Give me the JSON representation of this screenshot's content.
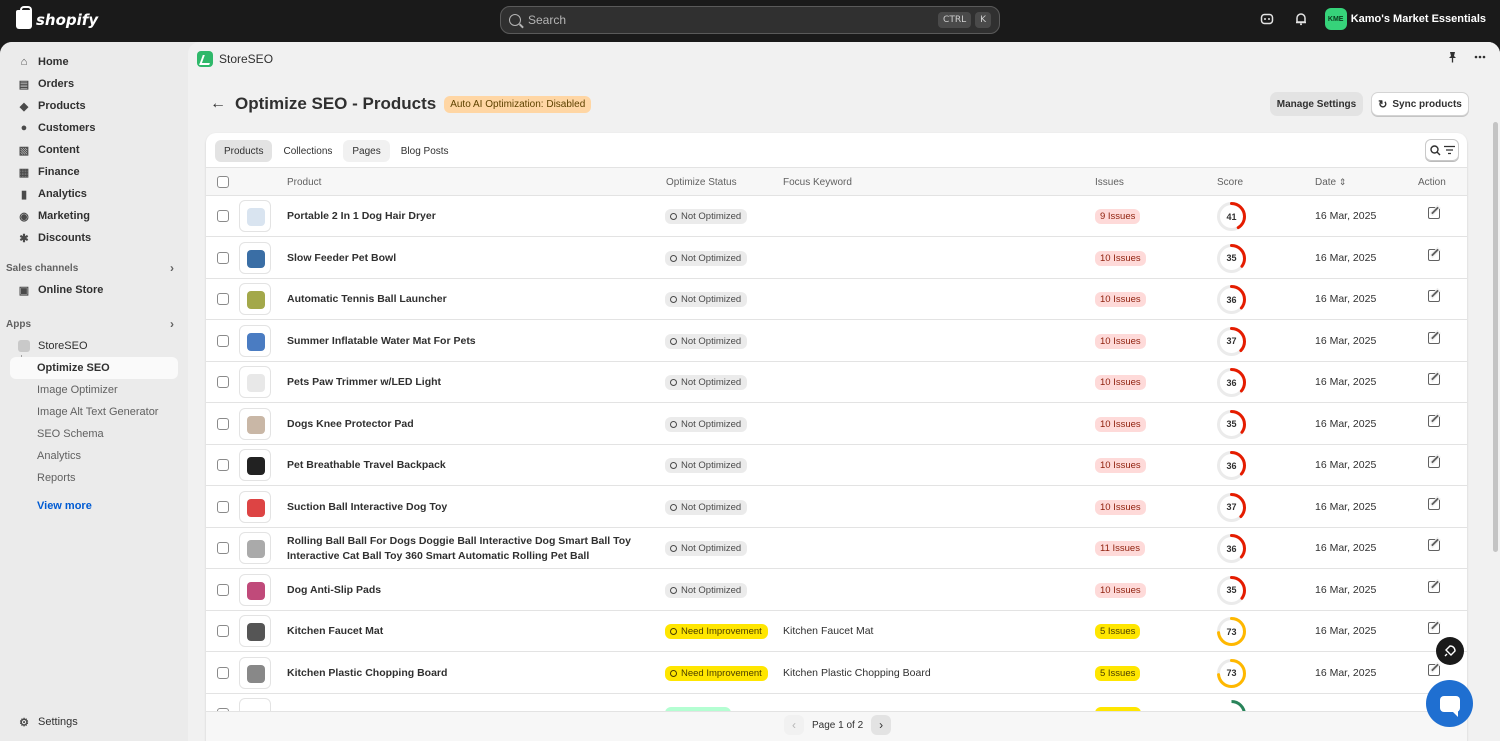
{
  "topbar": {
    "brand": "shopify",
    "search_placeholder": "Search",
    "shortcut_1": "CTRL",
    "shortcut_2": "K",
    "store_initials": "KME",
    "store_name": "Kamo's Market Essentials"
  },
  "sidebar": {
    "items": [
      {
        "label": "Home",
        "icon": "home-icon"
      },
      {
        "label": "Orders",
        "icon": "orders-icon"
      },
      {
        "label": "Products",
        "icon": "tag-icon"
      },
      {
        "label": "Customers",
        "icon": "person-icon"
      },
      {
        "label": "Content",
        "icon": "content-icon"
      },
      {
        "label": "Finance",
        "icon": "bank-icon"
      },
      {
        "label": "Analytics",
        "icon": "chart-icon"
      },
      {
        "label": "Marketing",
        "icon": "target-icon"
      },
      {
        "label": "Discounts",
        "icon": "discount-icon"
      }
    ],
    "sales_channels_label": "Sales channels",
    "online_store": "Online Store",
    "apps_label": "Apps",
    "app_name": "StoreSEO",
    "app_subitems": [
      "Optimize SEO",
      "Image Optimizer",
      "Image Alt Text Generator",
      "SEO Schema",
      "Analytics",
      "Reports"
    ],
    "view_more": "View more",
    "settings": "Settings"
  },
  "appbar": {
    "name": "StoreSEO"
  },
  "page": {
    "title": "Optimize SEO - Products",
    "badge": "Auto AI Optimization: Disabled",
    "manage_settings": "Manage Settings",
    "sync_products": "Sync products"
  },
  "tabs": [
    "Products",
    "Collections",
    "Pages",
    "Blog Posts"
  ],
  "table": {
    "headers": {
      "product": "Product",
      "status": "Optimize Status",
      "keyword": "Focus Keyword",
      "issues": "Issues",
      "score": "Score",
      "date": "Date",
      "action": "Action"
    },
    "rows": [
      {
        "name": "Portable  2 In 1 Dog Hair Dryer",
        "status": "Not Optimized",
        "status_type": "not",
        "keyword": "",
        "issues": "9 Issues",
        "issues_type": "red",
        "score": 41,
        "date": "16 Mar, 2025"
      },
      {
        "name": "Slow Feeder Pet Bowl",
        "status": "Not Optimized",
        "status_type": "not",
        "keyword": "",
        "issues": "10 Issues",
        "issues_type": "red",
        "score": 35,
        "date": "16 Mar, 2025"
      },
      {
        "name": "Automatic Tennis Ball Launcher",
        "status": "Not Optimized",
        "status_type": "not",
        "keyword": "",
        "issues": "10 Issues",
        "issues_type": "red",
        "score": 36,
        "date": "16 Mar, 2025"
      },
      {
        "name": "Summer Inflatable Water Mat For Pets",
        "status": "Not Optimized",
        "status_type": "not",
        "keyword": "",
        "issues": "10 Issues",
        "issues_type": "red",
        "score": 37,
        "date": "16 Mar, 2025"
      },
      {
        "name": "Pets Paw Trimmer w/LED Light",
        "status": "Not Optimized",
        "status_type": "not",
        "keyword": "",
        "issues": "10 Issues",
        "issues_type": "red",
        "score": 36,
        "date": "16 Mar, 2025"
      },
      {
        "name": "Dogs Knee Protector Pad",
        "status": "Not Optimized",
        "status_type": "not",
        "keyword": "",
        "issues": "10 Issues",
        "issues_type": "red",
        "score": 35,
        "date": "16 Mar, 2025"
      },
      {
        "name": "Pet Breathable Travel Backpack",
        "status": "Not Optimized",
        "status_type": "not",
        "keyword": "",
        "issues": "10 Issues",
        "issues_type": "red",
        "score": 36,
        "date": "16 Mar, 2025"
      },
      {
        "name": "Suction Ball Interactive Dog Toy",
        "status": "Not Optimized",
        "status_type": "not",
        "keyword": "",
        "issues": "10 Issues",
        "issues_type": "red",
        "score": 37,
        "date": "16 Mar, 2025"
      },
      {
        "name": "Rolling Ball Ball For Dogs Doggie Ball Interactive Dog Smart Ball Toy Interactive Cat Ball Toy 360 Smart Automatic Rolling Pet Ball",
        "status": "Not Optimized",
        "status_type": "not",
        "keyword": "",
        "issues": "11 Issues",
        "issues_type": "red",
        "score": 36,
        "date": "16 Mar, 2025"
      },
      {
        "name": "Dog Anti-Slip Pads",
        "status": "Not Optimized",
        "status_type": "not",
        "keyword": "",
        "issues": "10 Issues",
        "issues_type": "red",
        "score": 35,
        "date": "16 Mar, 2025"
      },
      {
        "name": "Kitchen Faucet Mat",
        "status": "Need Improvement",
        "status_type": "need",
        "keyword": "Kitchen Faucet Mat",
        "issues": "5 Issues",
        "issues_type": "yellow",
        "score": 73,
        "date": "16 Mar, 2025"
      },
      {
        "name": "Kitchen Plastic Chopping Board",
        "status": "Need Improvement",
        "status_type": "need",
        "keyword": "Kitchen Plastic Chopping Board",
        "issues": "5 Issues",
        "issues_type": "yellow",
        "score": 73,
        "date": "16 Mar, 2025"
      }
    ]
  },
  "pagination": {
    "label": "Page 1 of 2"
  },
  "colors": {
    "score_red": "#e51c00",
    "score_yellow": "#ffb800",
    "score_green": "#29845a",
    "ring_bg": "#ebebeb"
  }
}
